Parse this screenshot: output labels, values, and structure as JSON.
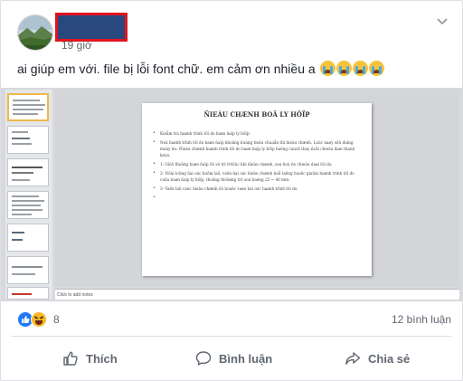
{
  "post": {
    "author_name": "",
    "timestamp": "19 giờ",
    "text": "ai giúp em với. file bị lỗi font chữ. em cảm ơn nhiều a",
    "emoji_count": 4
  },
  "attachment": {
    "slide_title": "ÑIEÀU CHÆNH BOÄ LY HÔÏP",
    "slide_bullets": [
      "Kieåm tra haønh trình töï do baøn ñaïp ly hôïp:",
      "Neá haønh trình töï do baøn ñaïp khoâng ñuùng tieâu chuaån thì ñieàu chænh. Luùc naøy söû duïng maùy ño: Ñieàu chænh haønh trình töï do baøn ñaïp ly hôïp baèng caùch thay ñoåi chieàu daøi thanh keùo.",
      "1- Giöõ thoâng baøn ñaïp ôû vò trí tröôùc khi ñieàu chænh, sau ñoù ño chieàu daøi töï do.",
      "2- Nôùi loûng ñai oác haõm laïi, vaën ñai oác ñieàu chænh ñeå taêng hoaëc giaûm haønh trình töï do cuûa baøn ñaïp ly hôïp; thoâng thöôøng trò soá baèng 25 ~ 40 mm.",
      "3- Vaën laïi caùc ñieàu chænh ôû hoaëc vaøo ñai oác haønh trình töï do.",
      ""
    ],
    "notes_placeholder": "Click to add notes"
  },
  "stats": {
    "reaction_count": "8",
    "comment_count": "12 bình luận"
  },
  "actions": {
    "like": "Thích",
    "comment": "Bình luận",
    "share": "Chia sẻ"
  },
  "icons": {
    "like": "thumbs-up-icon",
    "comment": "speech-bubble-icon",
    "share": "share-arrow-icon",
    "menu": "chevron-down-icon"
  },
  "colors": {
    "facebook_blue": "#2078f4",
    "redaction_outline": "#e0141e",
    "redaction_fill": "#29487d",
    "secondary_text": "#606770"
  }
}
